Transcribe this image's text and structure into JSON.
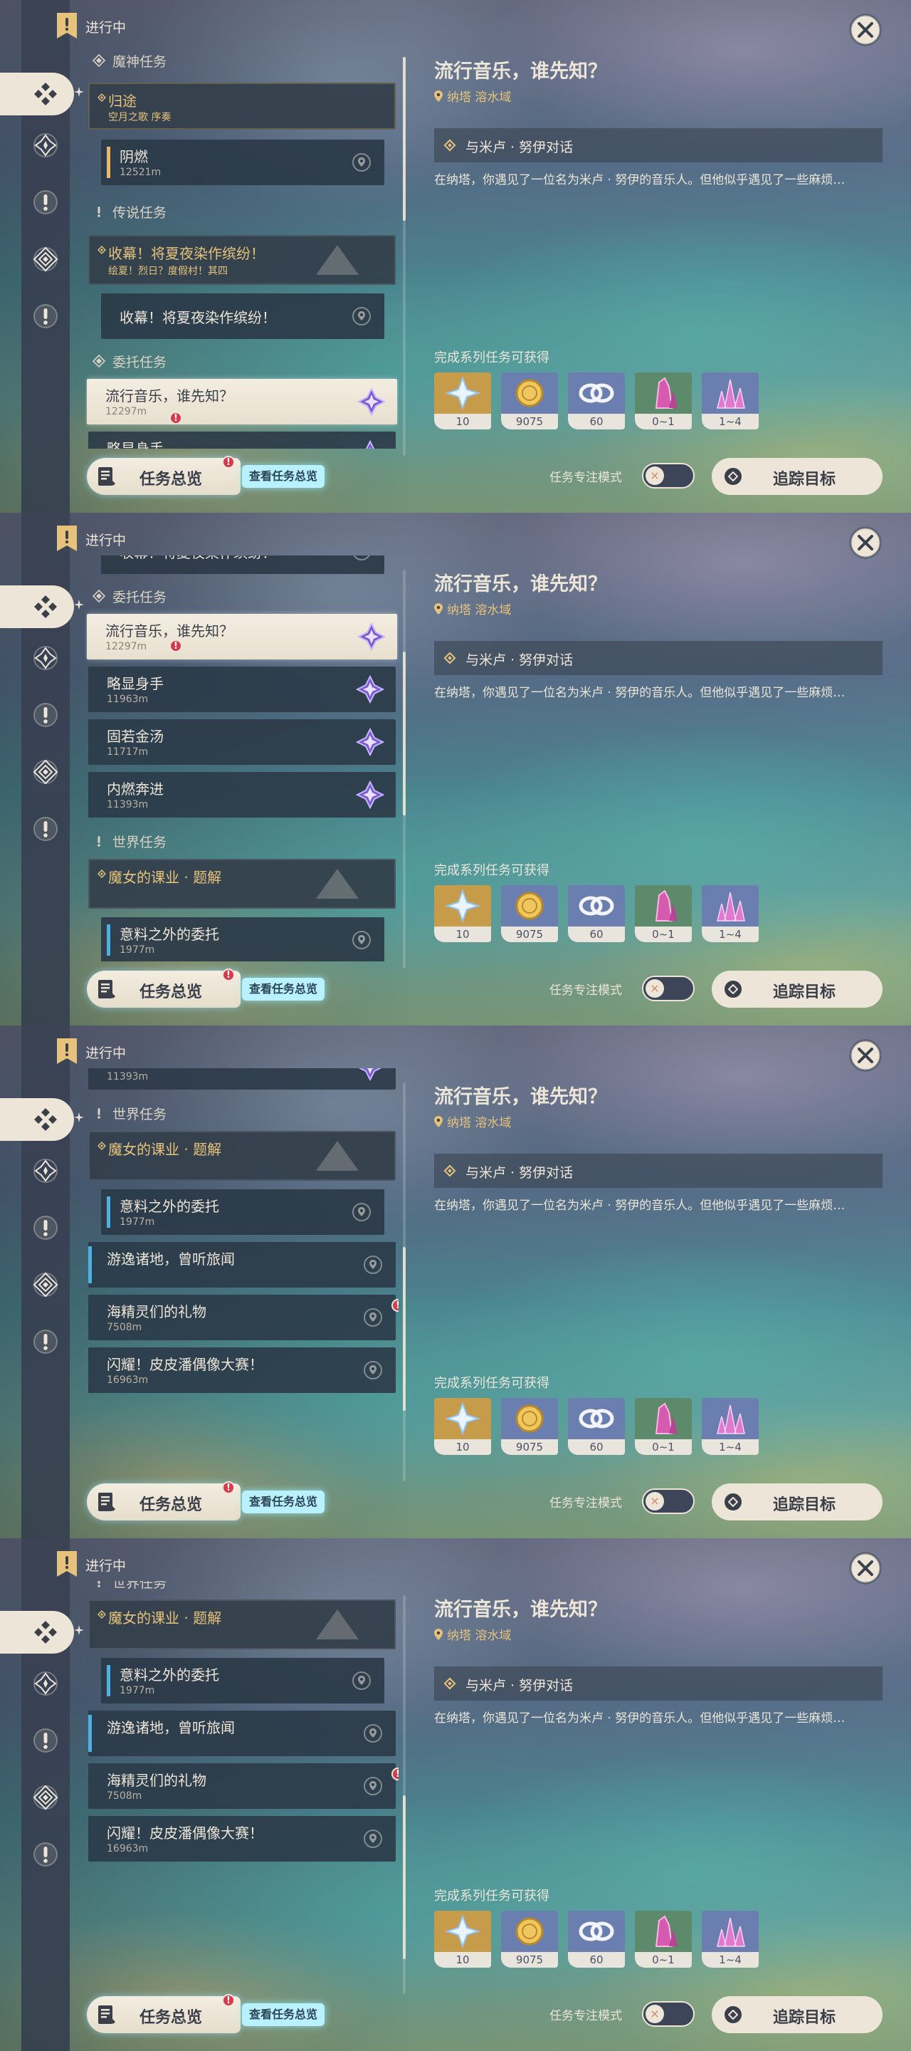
{
  "header": {
    "ongoing_label": "进行中"
  },
  "categories": {
    "archon": "魔神任务",
    "legend": "传说任务",
    "commission": "委托任务",
    "world": "世界任务"
  },
  "quests": {
    "guitu": {
      "title": "归途",
      "subtitle": "空月之歌 序奏"
    },
    "yinran": {
      "title": "阴燃",
      "distance": "12521m"
    },
    "shoumu": {
      "title": "收幕！将夏夜染作缤纷！",
      "subtitle": "绘夏！烈日？度假村！其四"
    },
    "shoumu_sub": {
      "title": "收幕！将夏夜染作缤纷！"
    },
    "liuxing": {
      "title": "流行音乐，谁先知？",
      "distance": "12297m"
    },
    "lue": {
      "title": "略显身手",
      "distance": "11963m"
    },
    "guruo": {
      "title": "固若金汤",
      "distance": "11717m"
    },
    "neiran": {
      "title": "内燃奔进",
      "distance": "11393m"
    },
    "monv": {
      "title": "魔女的课业 · 题解"
    },
    "yiliao": {
      "title": "意料之外的委托",
      "distance": "1977m"
    },
    "youyi": {
      "title": "游逸诸地，曾听旅闻"
    },
    "haijing": {
      "title": "海精灵们的礼物",
      "distance": "7508m"
    },
    "shanyao": {
      "title": "闪耀！皮皮潘偶像大赛！",
      "distance": "16963m"
    }
  },
  "overview": {
    "label": "任务总览",
    "tip": "查看任务总览",
    "badge": "!"
  },
  "detail": {
    "title": "流行音乐，谁先知？",
    "location": "纳塔  溶水域",
    "step": "与米卢 · 努伊对话",
    "description": "在纳塔，你遇见了一位名为米卢 · 努伊的音乐人。但他似乎遇见了一些麻烦…",
    "reward_label": "完成系列任务可获得",
    "rewards": [
      {
        "icon": "adventure-exp-star-icon",
        "count": "10",
        "bg": "#c69c4a"
      },
      {
        "icon": "mora-coin-icon",
        "count": "9075",
        "bg": "#6a7fb0"
      },
      {
        "icon": "friendship-exp-icon",
        "count": "60",
        "bg": "#6a7fb0"
      },
      {
        "icon": "crystal-chunk-icon",
        "count": "0~1",
        "bg": "#5c8a6a"
      },
      {
        "icon": "crystal-cluster-icon",
        "count": "1~4",
        "bg": "#6a7fb0"
      }
    ],
    "focus_mode_label": "任务专注模式",
    "toggle_knob": "×",
    "track_label": "追踪目标"
  },
  "colors": {
    "gold": "#e6c27b",
    "cream": "#ece5d8",
    "dark_text": "#3b3f4a",
    "alert": "#d53b48",
    "quest_purple": "#7a5bd0"
  },
  "scroll_progress": [
    0.0,
    0.35,
    0.7,
    0.85
  ]
}
